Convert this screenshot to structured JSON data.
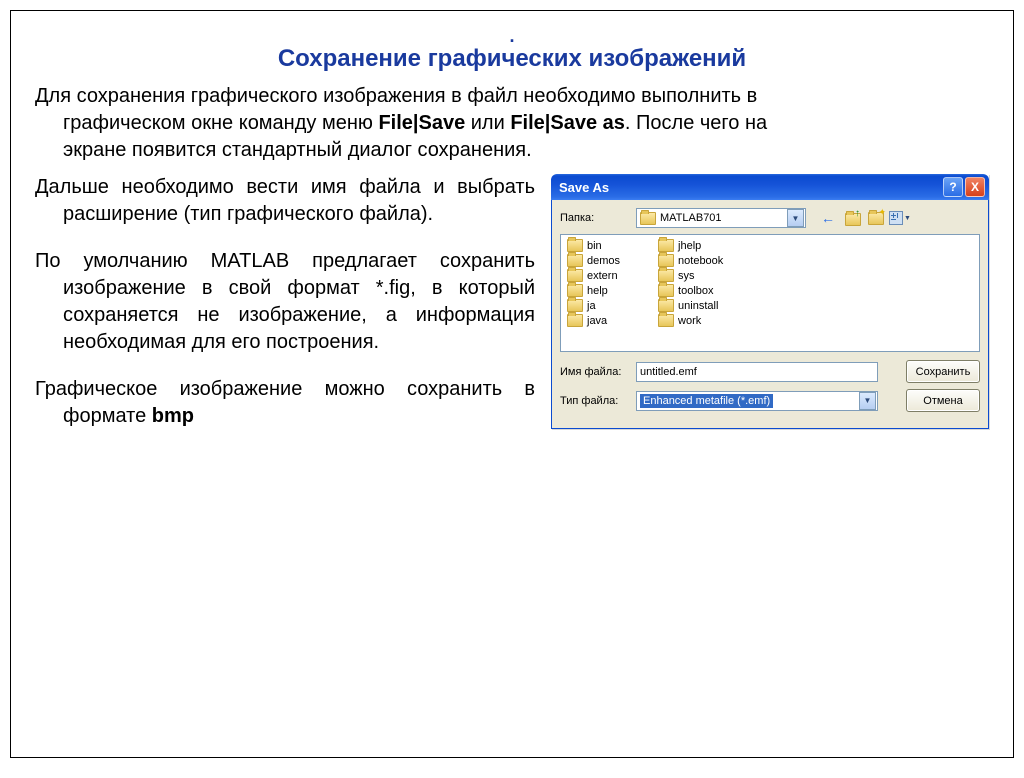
{
  "heading_dot": ".",
  "heading": "Сохранение графических изображений",
  "intro_line1": "Для сохранения графического изображения в файл необходимо выполнить в",
  "intro_line2_a": "графическом окне команду меню ",
  "intro_bold1": "File|Save",
  "intro_line2_b": " или ",
  "intro_bold2": "File|Save as",
  "intro_line2_c": ". После чего на",
  "intro_line3": "экране появится стандартный диалог сохранения.",
  "para1": "Дальше необходимо вести имя файла и выбрать расширение (тип графического файла).",
  "para2": "По умолчанию MATLAB предлагает сохранить изображение в свой формат *.fig, в который сохраняется не изображение, а информация необходимая для его построения.",
  "para3_a": "Графическое изображение можно сохранить в формате ",
  "para3_bold": "bmp",
  "dlg": {
    "title": "Save As",
    "help": "?",
    "close": "X",
    "folder_label": "Папка:",
    "folder_value": "MATLAB701",
    "files_col1": [
      "bin",
      "demos",
      "extern",
      "help",
      "ja",
      "java"
    ],
    "files_col2": [
      "jhelp",
      "notebook",
      "sys",
      "toolbox",
      "uninstall",
      "work"
    ],
    "filename_label": "Имя файла:",
    "filename_value": "untitled.emf",
    "filetype_label": "Тип файла:",
    "filetype_value": "Enhanced metafile (*.emf)",
    "save_btn": "Сохранить",
    "cancel_btn": "Отмена"
  }
}
